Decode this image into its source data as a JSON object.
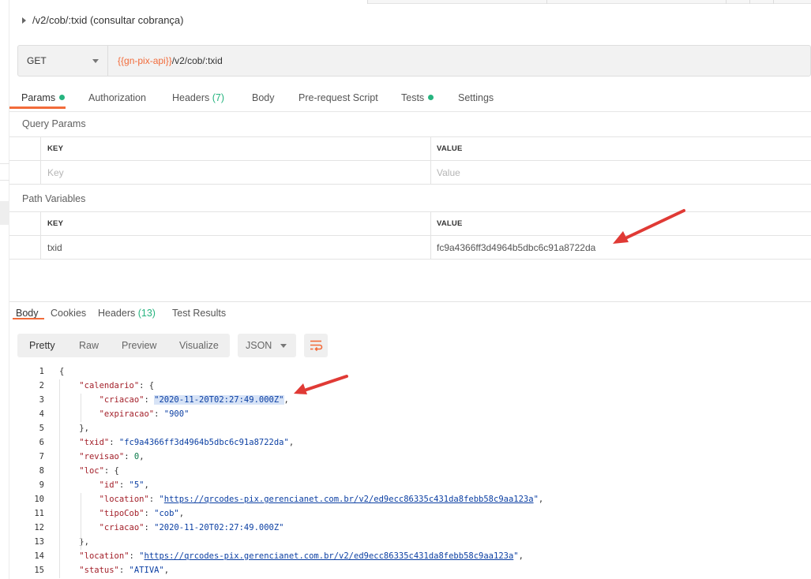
{
  "request": {
    "title": "/v2/cob/:txid (consultar cobrança)",
    "method": "GET",
    "url_variable": "{{gn-pix-api}}",
    "url_path": "/v2/cob/:txid"
  },
  "request_tabs": {
    "params": "Params",
    "authorization": "Authorization",
    "headers": "Headers",
    "headers_count": "(7)",
    "body": "Body",
    "prerequest": "Pre-request Script",
    "tests": "Tests",
    "settings": "Settings"
  },
  "query_params": {
    "title": "Query Params",
    "key_header": "KEY",
    "value_header": "VALUE",
    "key_placeholder": "Key",
    "value_placeholder": "Value"
  },
  "path_variables": {
    "title": "Path Variables",
    "key_header": "KEY",
    "value_header": "VALUE",
    "rows": [
      {
        "key": "txid",
        "value": "fc9a4366ff3d4964b5dbc6c91a8722da"
      }
    ]
  },
  "response_tabs": {
    "body": "Body",
    "cookies": "Cookies",
    "headers": "Headers",
    "headers_count": "(13)",
    "test_results": "Test Results"
  },
  "format_buttons": {
    "pretty": "Pretty",
    "raw": "Raw",
    "preview": "Preview",
    "visualize": "Visualize",
    "language": "JSON"
  },
  "colors": {
    "accent": "#f26b3a",
    "status_green": "#26b47f",
    "arrow_red": "#e03a35"
  },
  "icons": {
    "wrap": "wrap-lines-icon",
    "dropdown": "chevron-down-icon",
    "collapse": "caret-right-icon"
  },
  "response_json": [
    {
      "n": "1",
      "indent": 0,
      "parts": [
        {
          "t": "p",
          "v": "{"
        }
      ]
    },
    {
      "n": "2",
      "indent": 1,
      "parts": [
        {
          "t": "k",
          "v": "\"calendario\""
        },
        {
          "t": "p",
          "v": ": {"
        }
      ]
    },
    {
      "n": "3",
      "indent": 2,
      "parts": [
        {
          "t": "k",
          "v": "\"criacao\""
        },
        {
          "t": "p",
          "v": ": "
        },
        {
          "t": "sh",
          "v": "\"2020-11-20T02:27:49.000Z\""
        },
        {
          "t": "p",
          "v": ","
        }
      ]
    },
    {
      "n": "4",
      "indent": 2,
      "parts": [
        {
          "t": "k",
          "v": "\"expiracao\""
        },
        {
          "t": "p",
          "v": ": "
        },
        {
          "t": "s",
          "v": "\"900\""
        }
      ]
    },
    {
      "n": "5",
      "indent": 1,
      "parts": [
        {
          "t": "p",
          "v": "},"
        }
      ]
    },
    {
      "n": "6",
      "indent": 1,
      "parts": [
        {
          "t": "k",
          "v": "\"txid\""
        },
        {
          "t": "p",
          "v": ": "
        },
        {
          "t": "s",
          "v": "\"fc9a4366ff3d4964b5dbc6c91a8722da\""
        },
        {
          "t": "p",
          "v": ","
        }
      ]
    },
    {
      "n": "7",
      "indent": 1,
      "parts": [
        {
          "t": "k",
          "v": "\"revisao\""
        },
        {
          "t": "p",
          "v": ": "
        },
        {
          "t": "num",
          "v": "0"
        },
        {
          "t": "p",
          "v": ","
        }
      ]
    },
    {
      "n": "8",
      "indent": 1,
      "parts": [
        {
          "t": "k",
          "v": "\"loc\""
        },
        {
          "t": "p",
          "v": ": {"
        }
      ]
    },
    {
      "n": "9",
      "indent": 2,
      "parts": [
        {
          "t": "k",
          "v": "\"id\""
        },
        {
          "t": "p",
          "v": ": "
        },
        {
          "t": "s",
          "v": "\"5\""
        },
        {
          "t": "p",
          "v": ","
        }
      ]
    },
    {
      "n": "10",
      "indent": 2,
      "parts": [
        {
          "t": "k",
          "v": "\"location\""
        },
        {
          "t": "p",
          "v": ": "
        },
        {
          "t": "s",
          "v": "\""
        },
        {
          "t": "link",
          "v": "https://qrcodes-pix.gerencianet.com.br/v2/ed9ecc86335c431da8febb58c9aa123a"
        },
        {
          "t": "s",
          "v": "\""
        },
        {
          "t": "p",
          "v": ","
        }
      ]
    },
    {
      "n": "11",
      "indent": 2,
      "parts": [
        {
          "t": "k",
          "v": "\"tipoCob\""
        },
        {
          "t": "p",
          "v": ": "
        },
        {
          "t": "s",
          "v": "\"cob\""
        },
        {
          "t": "p",
          "v": ","
        }
      ]
    },
    {
      "n": "12",
      "indent": 2,
      "parts": [
        {
          "t": "k",
          "v": "\"criacao\""
        },
        {
          "t": "p",
          "v": ": "
        },
        {
          "t": "s",
          "v": "\"2020-11-20T02:27:49.000Z\""
        }
      ]
    },
    {
      "n": "13",
      "indent": 1,
      "parts": [
        {
          "t": "p",
          "v": "},"
        }
      ]
    },
    {
      "n": "14",
      "indent": 1,
      "parts": [
        {
          "t": "k",
          "v": "\"location\""
        },
        {
          "t": "p",
          "v": ": "
        },
        {
          "t": "s",
          "v": "\""
        },
        {
          "t": "link",
          "v": "https://qrcodes-pix.gerencianet.com.br/v2/ed9ecc86335c431da8febb58c9aa123a"
        },
        {
          "t": "s",
          "v": "\""
        },
        {
          "t": "p",
          "v": ","
        }
      ]
    },
    {
      "n": "15",
      "indent": 1,
      "parts": [
        {
          "t": "k",
          "v": "\"status\""
        },
        {
          "t": "p",
          "v": ": "
        },
        {
          "t": "s",
          "v": "\"ATIVA\""
        },
        {
          "t": "p",
          "v": ","
        }
      ]
    }
  ]
}
